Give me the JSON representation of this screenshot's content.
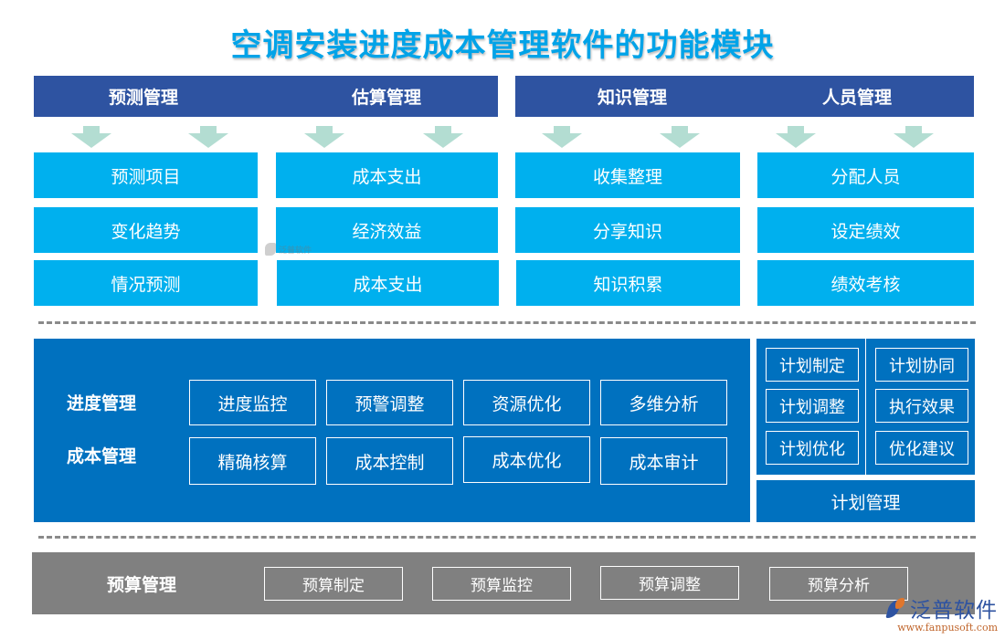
{
  "title": "空调安装进度成本管理软件的功能模块",
  "top_sections": {
    "headers": [
      "预测管理",
      "估算管理",
      "知识管理",
      "人员管理"
    ],
    "columns": [
      {
        "items": [
          "预测项目",
          "变化趋势",
          "情况预测"
        ]
      },
      {
        "items": [
          "成本支出",
          "经济效益",
          "成本支出"
        ]
      },
      {
        "items": [
          "收集整理",
          "分享知识",
          "知识积累"
        ]
      },
      {
        "items": [
          "分配人员",
          "设定绩效",
          "绩效考核"
        ]
      }
    ]
  },
  "middle": {
    "rows": [
      {
        "label": "进度管理",
        "items": [
          "进度监控",
          "预警调整",
          "资源优化",
          "多维分析"
        ]
      },
      {
        "label": "成本管理",
        "items": [
          "精确核算",
          "成本控制",
          "成本优化",
          "成本审计"
        ]
      }
    ]
  },
  "plan": {
    "left": [
      "计划制定",
      "计划调整",
      "计划优化"
    ],
    "right": [
      "计划协同",
      "执行效果",
      "优化建议"
    ],
    "footer": "计划管理"
  },
  "budget": {
    "label": "预算管理",
    "items": [
      "预算制定",
      "预算监控",
      "预算调整",
      "预算分析"
    ]
  },
  "watermark": {
    "center_text": "泛普软件",
    "brand_name": "泛普软件",
    "brand_url": "www.fanpusoft.com"
  },
  "colors": {
    "title": "#00a3e8",
    "header": "#2e53a1",
    "sub_item": "#00b0ee",
    "arrow": "#b3ddd2",
    "middle": "#0071bf",
    "budget": "#808080"
  }
}
